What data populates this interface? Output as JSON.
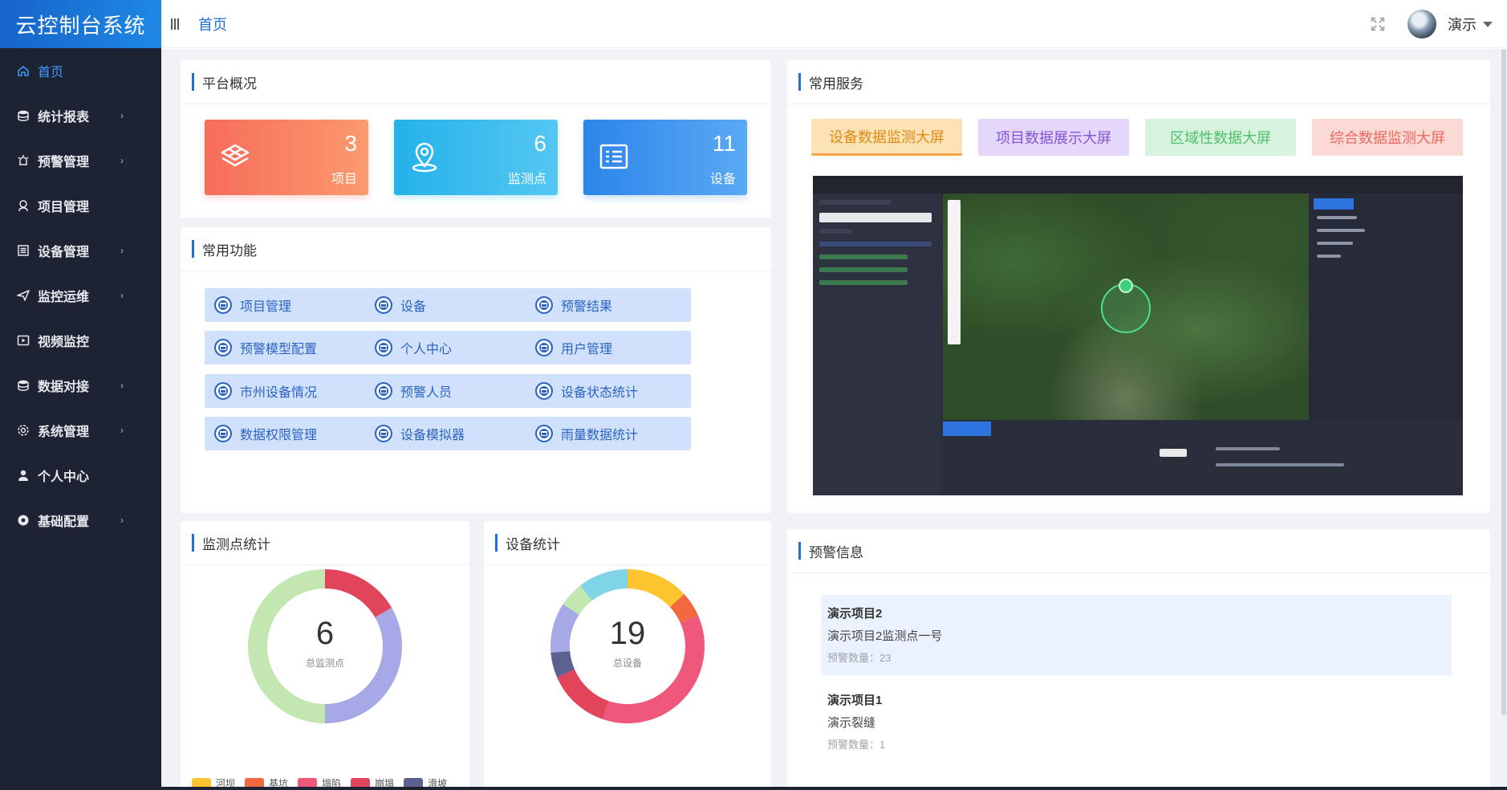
{
  "app": {
    "title": "云控制台系统"
  },
  "sidebar": {
    "items": [
      {
        "label": "首页",
        "icon": "home-icon",
        "active": true,
        "has_arrow": false
      },
      {
        "label": "统计报表",
        "icon": "database-icon",
        "has_arrow": true
      },
      {
        "label": "预警管理",
        "icon": "alarm-icon",
        "has_arrow": true
      },
      {
        "label": "项目管理",
        "icon": "location-icon",
        "has_arrow": false
      },
      {
        "label": "设备管理",
        "icon": "list-icon",
        "has_arrow": true
      },
      {
        "label": "监控运维",
        "icon": "send-icon",
        "has_arrow": true
      },
      {
        "label": "视频监控",
        "icon": "video-icon",
        "has_arrow": false
      },
      {
        "label": "数据对接",
        "icon": "database-icon",
        "has_arrow": true
      },
      {
        "label": "系统管理",
        "icon": "gear-icon",
        "has_arrow": true
      },
      {
        "label": "个人中心",
        "icon": "user-icon",
        "has_arrow": false
      },
      {
        "label": "基础配置",
        "icon": "gear-solid-icon",
        "has_arrow": true
      }
    ]
  },
  "header": {
    "breadcrumb": "首页",
    "username": "演示"
  },
  "overview": {
    "title": "平台概况",
    "tiles": [
      {
        "value": "3",
        "label": "项目",
        "icon": "layers-icon",
        "color": "#f76d5b"
      },
      {
        "value": "6",
        "label": "监测点",
        "icon": "location-pin-icon",
        "color": "#24b2ea"
      },
      {
        "value": "11",
        "label": "设备",
        "icon": "list-box-icon",
        "color": "#2c85e8"
      }
    ]
  },
  "functions": {
    "title": "常用功能",
    "items": [
      "项目管理",
      "设备",
      "预警结果",
      "预警模型配置",
      "个人中心",
      "用户管理",
      "市州设备情况",
      "预警人员",
      "设备状态统计",
      "数据权限管理",
      "设备模拟器",
      "雨量数据统计"
    ]
  },
  "services": {
    "title": "常用服务",
    "items": [
      "设备数据监测大屏",
      "项目数据展示大屏",
      "区域性数据大屏",
      "综合数据监测大屏"
    ]
  },
  "monitor_stats": {
    "title": "监测点统计",
    "total": "6",
    "total_label": "总监测点"
  },
  "device_stats": {
    "title": "设备统计",
    "total": "19",
    "total_label": "总设备"
  },
  "warnings": {
    "title": "预警信息",
    "items": [
      {
        "project": "演示项目2",
        "point": "演示项目2监测点一号",
        "count": "预警数量：23",
        "highlight": true
      },
      {
        "project": "演示项目1",
        "point": "演示裂缝",
        "count": "预警数量：1",
        "highlight": false
      }
    ]
  },
  "chart_data": [
    {
      "type": "pie",
      "title": "监测点统计",
      "categories": [
        "河坝",
        "基坑",
        "塌陷",
        "崩塌",
        "滑坡"
      ],
      "legend": [
        "河坝",
        "基坑",
        "塌陷",
        "崩塌",
        "滑坡"
      ],
      "slices": [
        {
          "color": "#e0455c",
          "value": 1
        },
        {
          "color": "#a6a9e6",
          "value": 2
        },
        {
          "color": "#c3e7b0",
          "value": 3
        }
      ],
      "colors": [
        "#fcc52f",
        "#f2693f",
        "#f0587b",
        "#e0455c",
        "#5b6191"
      ],
      "legend_placement": "bottom"
    },
    {
      "type": "pie",
      "title": "设备统计",
      "slices": [
        {
          "color": "#fcc52f",
          "value": 2.5
        },
        {
          "color": "#f2693f",
          "value": 1
        },
        {
          "color": "#f0587b",
          "value": 7
        },
        {
          "color": "#e0455c",
          "value": 2.5
        },
        {
          "color": "#5b6191",
          "value": 1
        },
        {
          "color": "#a6a9e6",
          "value": 2
        },
        {
          "color": "#c3e7b0",
          "value": 1
        },
        {
          "color": "#7fd4e6",
          "value": 2
        }
      ]
    }
  ]
}
